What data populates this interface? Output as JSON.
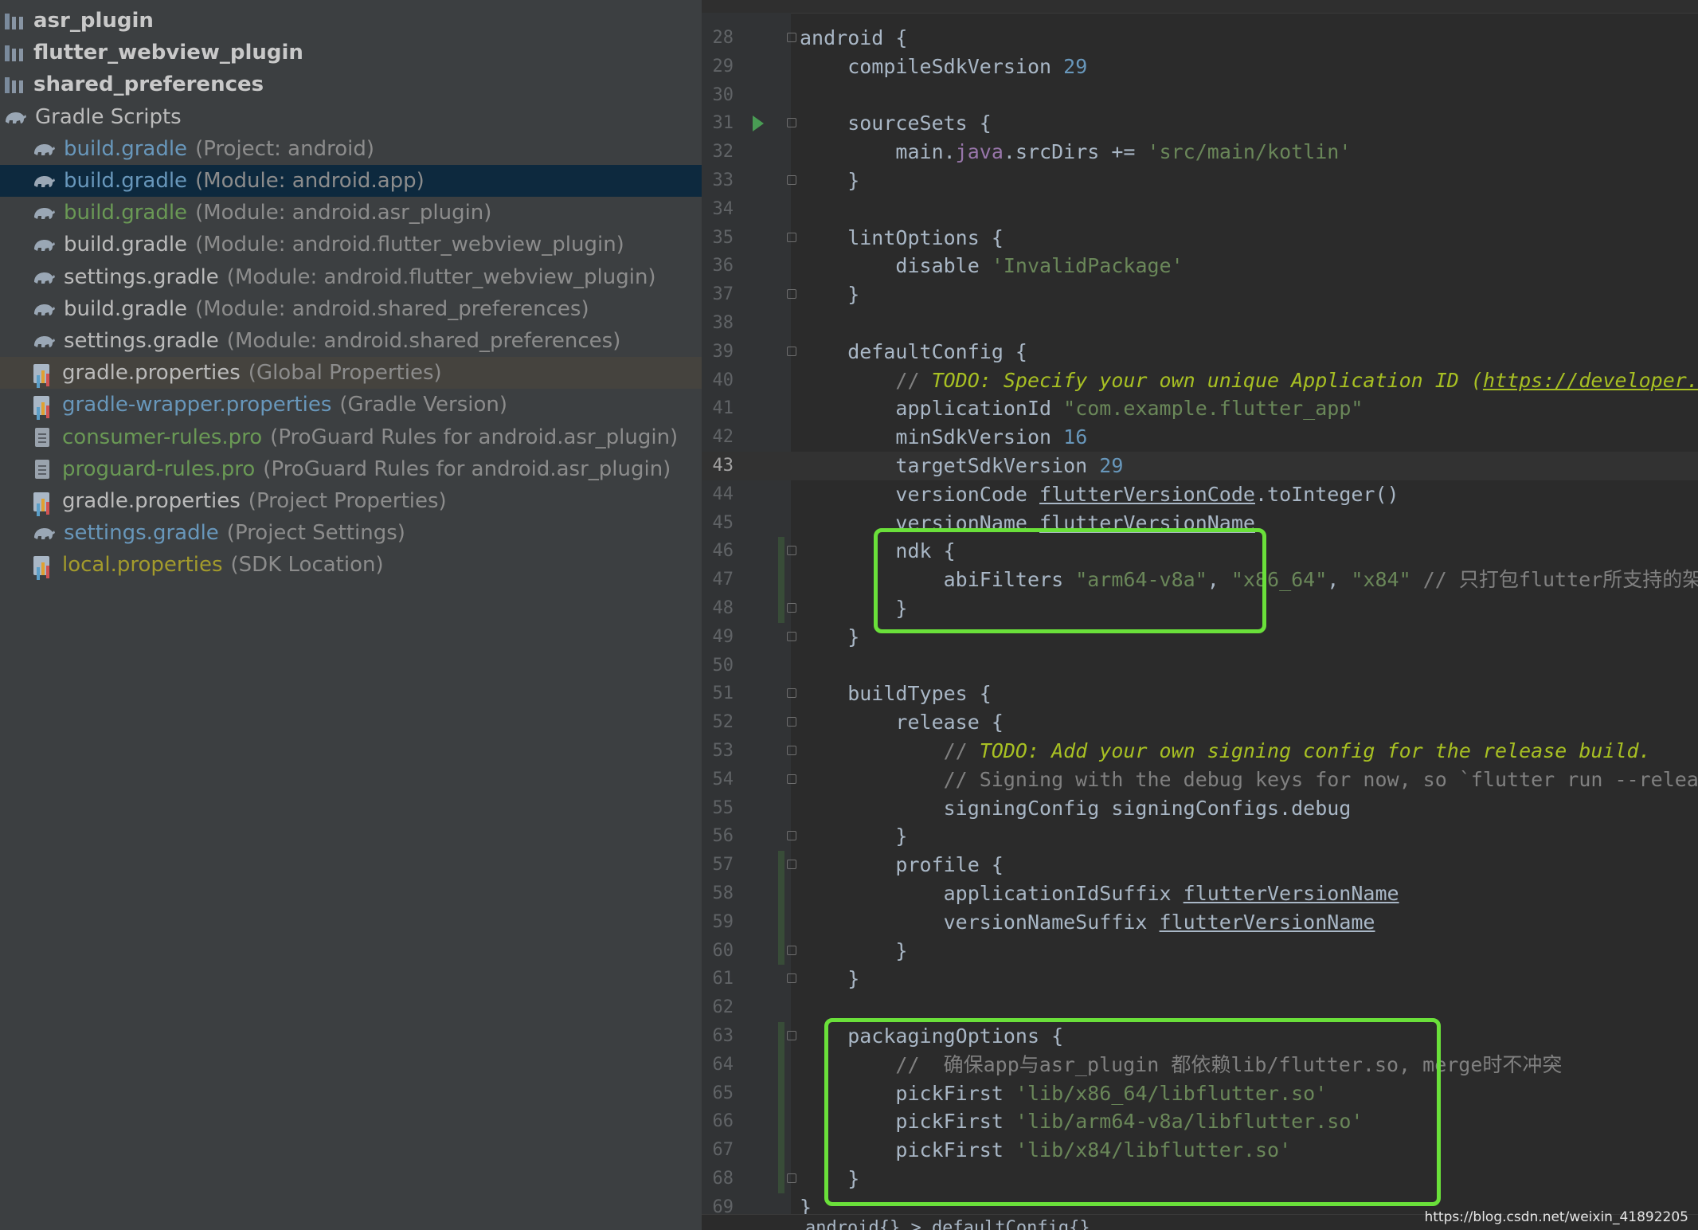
{
  "project_tree": {
    "rows": [
      {
        "icon": "library-icon",
        "name": "asr_plugin",
        "hint": "",
        "name_color": "#c9c9c9",
        "bold": true
      },
      {
        "icon": "library-icon",
        "name": "flutter_webview_plugin",
        "hint": "",
        "name_color": "#c9c9c9",
        "bold": true
      },
      {
        "icon": "library-icon",
        "name": "shared_preferences",
        "hint": "",
        "name_color": "#c9c9c9",
        "bold": true
      },
      {
        "icon": "gradle-elephant-icon",
        "name": "Gradle Scripts",
        "hint": "",
        "name_color": "#bbbbbb",
        "indent": 0
      },
      {
        "icon": "gradle-elephant-icon",
        "name": "build.gradle",
        "hint": "(Project: android)",
        "name_color": "#6897bb",
        "indent": 1
      },
      {
        "icon": "gradle-elephant-icon",
        "name": "build.gradle",
        "hint": "(Module: android.app)",
        "name_color": "#6897bb",
        "indent": 1,
        "selected": true
      },
      {
        "icon": "gradle-elephant-icon",
        "name": "build.gradle",
        "hint": "(Module: android.asr_plugin)",
        "name_color": "#6a9955",
        "indent": 1
      },
      {
        "icon": "gradle-elephant-icon",
        "name": "build.gradle",
        "hint": "(Module: android.flutter_webview_plugin)",
        "name_color": "#bbbbbb",
        "indent": 1
      },
      {
        "icon": "gradle-elephant-icon",
        "name": "settings.gradle",
        "hint": "(Module: android.flutter_webview_plugin)",
        "name_color": "#bbbbbb",
        "indent": 1
      },
      {
        "icon": "gradle-elephant-icon",
        "name": "build.gradle",
        "hint": "(Module: android.shared_preferences)",
        "name_color": "#bbbbbb",
        "indent": 1
      },
      {
        "icon": "gradle-elephant-icon",
        "name": "settings.gradle",
        "hint": "(Module: android.shared_preferences)",
        "name_color": "#bbbbbb",
        "indent": 1
      },
      {
        "icon": "properties-icon",
        "name": "gradle.properties",
        "hint": "(Global Properties)",
        "name_color": "#bbbbbb",
        "indent": 1,
        "hover": true
      },
      {
        "icon": "properties-icon",
        "name": "gradle-wrapper.properties",
        "hint": "(Gradle Version)",
        "name_color": "#6897bb",
        "indent": 1
      },
      {
        "icon": "text-file-icon",
        "name": "consumer-rules.pro",
        "hint": "(ProGuard Rules for android.asr_plugin)",
        "name_color": "#6a9955",
        "indent": 1
      },
      {
        "icon": "text-file-icon",
        "name": "proguard-rules.pro",
        "hint": "(ProGuard Rules for android.asr_plugin)",
        "name_color": "#6a9955",
        "indent": 1
      },
      {
        "icon": "properties-icon",
        "name": "gradle.properties",
        "hint": "(Project Properties)",
        "name_color": "#bbbbbb",
        "indent": 1
      },
      {
        "icon": "gradle-elephant-icon",
        "name": "settings.gradle",
        "hint": "(Project Settings)",
        "name_color": "#6897bb",
        "indent": 1
      },
      {
        "icon": "properties-icon",
        "name": "local.properties",
        "hint": "(SDK Location)",
        "name_color": "#a39b2c",
        "indent": 1
      }
    ]
  },
  "editor": {
    "current_line": 43,
    "run_marker_line": 31,
    "fold_lines": [
      28,
      31,
      33,
      35,
      37,
      39,
      46,
      48,
      49,
      51,
      52,
      53,
      54,
      56,
      57,
      60,
      61,
      63,
      68
    ],
    "lines": [
      {
        "num": "28",
        "tokens": [
          [
            "k",
            "android {"
          ]
        ]
      },
      {
        "num": "29",
        "tokens": [
          [
            "k",
            "    compileSdkVersion "
          ],
          [
            "n",
            "29"
          ]
        ]
      },
      {
        "num": "30",
        "tokens": []
      },
      {
        "num": "31",
        "tokens": [
          [
            "k",
            "    sourceSets {"
          ]
        ]
      },
      {
        "num": "32",
        "tokens": [
          [
            "k",
            "        main."
          ],
          [
            "f",
            "java"
          ],
          [
            "k",
            ".srcDirs += "
          ],
          [
            "s",
            "'src/main/kotlin'"
          ]
        ]
      },
      {
        "num": "33",
        "tokens": [
          [
            "k",
            "    }"
          ]
        ]
      },
      {
        "num": "34",
        "tokens": []
      },
      {
        "num": "35",
        "tokens": [
          [
            "k",
            "    lintOptions {"
          ]
        ]
      },
      {
        "num": "36",
        "tokens": [
          [
            "k",
            "        disable "
          ],
          [
            "s",
            "'InvalidPackage'"
          ]
        ]
      },
      {
        "num": "37",
        "tokens": [
          [
            "k",
            "    }"
          ]
        ]
      },
      {
        "num": "38",
        "tokens": []
      },
      {
        "num": "39",
        "tokens": [
          [
            "k",
            "    defaultConfig {"
          ]
        ]
      },
      {
        "num": "40",
        "tokens": [
          [
            "c",
            "        // "
          ],
          [
            "todo",
            "TODO: Specify your own unique Application ID ("
          ],
          [
            "link",
            "https://developer.android.com/studio/build/application-id.html"
          ],
          [
            "todo",
            ")."
          ]
        ]
      },
      {
        "num": "41",
        "tokens": [
          [
            "k",
            "        applicationId "
          ],
          [
            "s",
            "\"com.example.flutter_app\""
          ]
        ]
      },
      {
        "num": "42",
        "tokens": [
          [
            "k",
            "        minSdkVersion "
          ],
          [
            "n",
            "16"
          ]
        ]
      },
      {
        "num": "43",
        "tokens": [
          [
            "k",
            "        targetSdkVersion "
          ],
          [
            "n",
            "29"
          ]
        ]
      },
      {
        "num": "44",
        "tokens": [
          [
            "k",
            "        versionCode "
          ],
          [
            "u",
            "flutterVersionCode"
          ],
          [
            "k",
            ".toInteger()"
          ]
        ]
      },
      {
        "num": "45",
        "tokens": [
          [
            "k",
            "        versionName "
          ],
          [
            "u",
            "flutterVersionName"
          ]
        ]
      },
      {
        "num": "46",
        "tokens": [
          [
            "k",
            "        ndk {"
          ]
        ]
      },
      {
        "num": "47",
        "tokens": [
          [
            "k",
            "            abiFilters "
          ],
          [
            "s",
            "\"arm64-v8a\""
          ],
          [
            "k",
            ", "
          ],
          [
            "s",
            "\"x86_64\""
          ],
          [
            "k",
            ", "
          ],
          [
            "s",
            "\"x84\""
          ],
          [
            "k",
            " "
          ],
          [
            "c",
            "// 只打包flutter所支持的架构, flutter没有armeabi架构的so"
          ]
        ]
      },
      {
        "num": "48",
        "tokens": [
          [
            "k",
            "        }"
          ]
        ]
      },
      {
        "num": "49",
        "tokens": [
          [
            "k",
            "    }"
          ]
        ]
      },
      {
        "num": "50",
        "tokens": []
      },
      {
        "num": "51",
        "tokens": [
          [
            "k",
            "    buildTypes {"
          ]
        ]
      },
      {
        "num": "52",
        "tokens": [
          [
            "k",
            "        release {"
          ]
        ]
      },
      {
        "num": "53",
        "tokens": [
          [
            "c",
            "            // "
          ],
          [
            "todo",
            "TODO: Add your own signing config for the release build."
          ]
        ]
      },
      {
        "num": "54",
        "tokens": [
          [
            "c",
            "            // Signing with the debug keys for now, so `flutter run --release` works."
          ]
        ]
      },
      {
        "num": "55",
        "tokens": [
          [
            "k",
            "            signingConfig signingConfigs.debug"
          ]
        ]
      },
      {
        "num": "56",
        "tokens": [
          [
            "k",
            "        }"
          ]
        ]
      },
      {
        "num": "57",
        "tokens": [
          [
            "k",
            "        profile {"
          ]
        ]
      },
      {
        "num": "58",
        "tokens": [
          [
            "k",
            "            applicationIdSuffix "
          ],
          [
            "u",
            "flutterVersionName"
          ]
        ]
      },
      {
        "num": "59",
        "tokens": [
          [
            "k",
            "            versionNameSuffix "
          ],
          [
            "u",
            "flutterVersionName"
          ]
        ]
      },
      {
        "num": "60",
        "tokens": [
          [
            "k",
            "        }"
          ]
        ]
      },
      {
        "num": "61",
        "tokens": [
          [
            "k",
            "    }"
          ]
        ]
      },
      {
        "num": "62",
        "tokens": []
      },
      {
        "num": "63",
        "tokens": [
          [
            "k",
            "    packagingOptions {"
          ]
        ]
      },
      {
        "num": "64",
        "tokens": [
          [
            "c",
            "        //  确保app与asr_plugin 都依赖lib/flutter.so, merge时不冲突"
          ]
        ]
      },
      {
        "num": "65",
        "tokens": [
          [
            "k",
            "        pickFirst "
          ],
          [
            "s",
            "'lib/x86_64/libflutter.so'"
          ]
        ]
      },
      {
        "num": "66",
        "tokens": [
          [
            "k",
            "        pickFirst "
          ],
          [
            "s",
            "'lib/arm64-v8a/libflutter.so'"
          ]
        ]
      },
      {
        "num": "67",
        "tokens": [
          [
            "k",
            "        pickFirst "
          ],
          [
            "s",
            "'lib/x84/libflutter.so'"
          ]
        ]
      },
      {
        "num": "68",
        "tokens": [
          [
            "k",
            "    }"
          ]
        ]
      },
      {
        "num": "69",
        "tokens": [
          [
            "k",
            "}"
          ]
        ]
      }
    ],
    "breadcrumb": "android{} > defaultConfig{}"
  },
  "watermark": "https://blog.csdn.net/weixin_41892205",
  "colors": {
    "tree_bg": "#3c3f41",
    "editor_bg": "#2b2b2b",
    "highlight_box": "#6ae03a",
    "selection": "#0d293e"
  }
}
